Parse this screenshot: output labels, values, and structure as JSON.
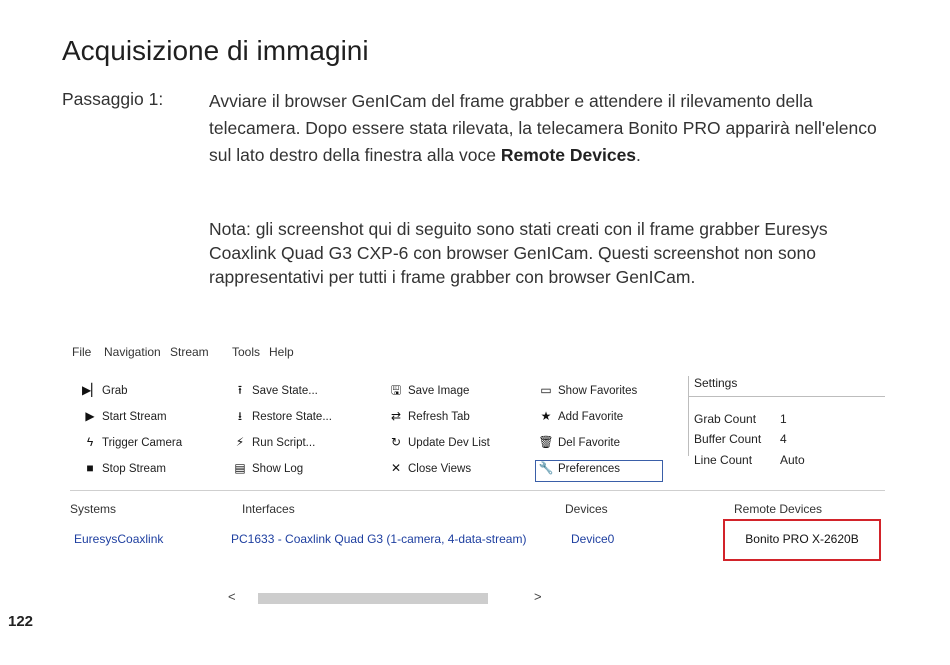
{
  "title": "Acquisizione di immagini",
  "step_label": "Passaggio 1:",
  "paragraph1": {
    "text": "Avviare il browser GenICam del frame grabber e attendere il rilevamento della telecamera. Dopo essere stata rilevata, la telecamera Bonito PRO apparirà nell'elenco sul lato destro della finestra alla voce ",
    "bold": "Remote Devices",
    "end": "."
  },
  "paragraph2": "Nota: gli screenshot qui di seguito sono stati creati con il frame grabber Euresys Coaxlink Quad G3 CXP-6 con browser GenICam. Questi screenshot non sono rappresentativi per tutti i frame grabber con browser GenICam.",
  "screenshot": {
    "menu": [
      "File",
      "Navigation",
      "Stream",
      "Tools",
      "Help"
    ],
    "toolbar": {
      "col1": [
        {
          "label": "Grab",
          "icon": "grab-icon",
          "glyph": "▶▏"
        },
        {
          "label": "Start Stream",
          "icon": "play-icon",
          "glyph": "▶"
        },
        {
          "label": "Trigger Camera",
          "icon": "lightning-icon",
          "glyph": "ϟ"
        },
        {
          "label": "Stop Stream",
          "icon": "stop-icon",
          "glyph": "■"
        }
      ],
      "col2": [
        {
          "label": "Save State...",
          "icon": "upload-icon",
          "glyph": "⭱"
        },
        {
          "label": "Restore State...",
          "icon": "download-icon",
          "glyph": "⭳"
        },
        {
          "label": "Run Script...",
          "icon": "run-icon",
          "glyph": "⚡"
        },
        {
          "label": "Show Log",
          "icon": "log-icon",
          "glyph": "▤"
        }
      ],
      "col3": [
        {
          "label": "Save Image",
          "icon": "floppy-icon",
          "glyph": "🖫"
        },
        {
          "label": "Refresh Tab",
          "icon": "refresh-icon",
          "glyph": "⇄"
        },
        {
          "label": "Update Dev List",
          "icon": "reload-icon",
          "glyph": "↻"
        },
        {
          "label": "Close Views",
          "icon": "close-icon",
          "glyph": "✕"
        }
      ],
      "col4": [
        {
          "label": "Show Favorites",
          "icon": "monitor-icon",
          "glyph": "▭"
        },
        {
          "label": "Add Favorite",
          "icon": "star-icon",
          "glyph": "★"
        },
        {
          "label": "Del Favorite",
          "icon": "trash-icon",
          "glyph": "🗑"
        },
        {
          "label": "Preferences",
          "icon": "wrench-icon",
          "glyph": "🔧"
        }
      ]
    },
    "settings": {
      "heading": "Settings",
      "rows": [
        {
          "label": "Grab Count",
          "value": "1"
        },
        {
          "label": "Buffer Count",
          "value": "4"
        },
        {
          "label": "Line Count",
          "value": "Auto"
        }
      ]
    },
    "columns": {
      "systems": {
        "header": "Systems",
        "value": "EuresysCoaxlink"
      },
      "interfaces": {
        "header": "Interfaces",
        "value": "PC1633 - Coaxlink Quad G3 (1-camera, 4-data-stream)"
      },
      "devices": {
        "header": "Devices",
        "value": "Device0"
      },
      "remote": {
        "header": "Remote Devices",
        "value": "Bonito PRO X-2620B"
      }
    },
    "scroll": {
      "left": "<",
      "right": ">"
    }
  },
  "page_number": "122"
}
